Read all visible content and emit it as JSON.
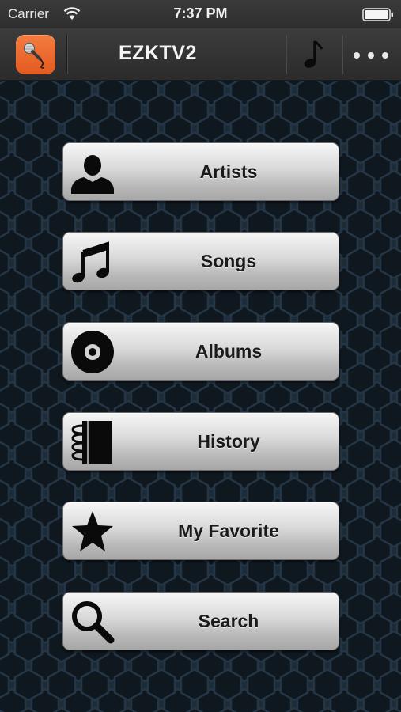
{
  "status_bar": {
    "carrier": "Carrier",
    "time": "7:37 PM",
    "icons": [
      "wifi-icon",
      "battery-icon"
    ]
  },
  "nav": {
    "title": "EZKTV2",
    "left_icon": "microphone-app-icon",
    "right_icons": [
      "music-note-icon",
      "more-dots-icon"
    ],
    "app_icon_color": "#ef6a2e"
  },
  "menu": {
    "items": [
      {
        "label": "Artists",
        "icon": "person-icon"
      },
      {
        "label": "Songs",
        "icon": "music-notes-icon"
      },
      {
        "label": "Albums",
        "icon": "disc-icon"
      },
      {
        "label": "History",
        "icon": "notebook-icon"
      },
      {
        "label": "My Favorite",
        "icon": "star-icon"
      },
      {
        "label": "Search",
        "icon": "magnifier-icon"
      }
    ]
  },
  "colors": {
    "background": "#1a2632",
    "button_top": "#f6f6f6",
    "button_bottom": "#a7a7a7",
    "bar": "#333333"
  }
}
